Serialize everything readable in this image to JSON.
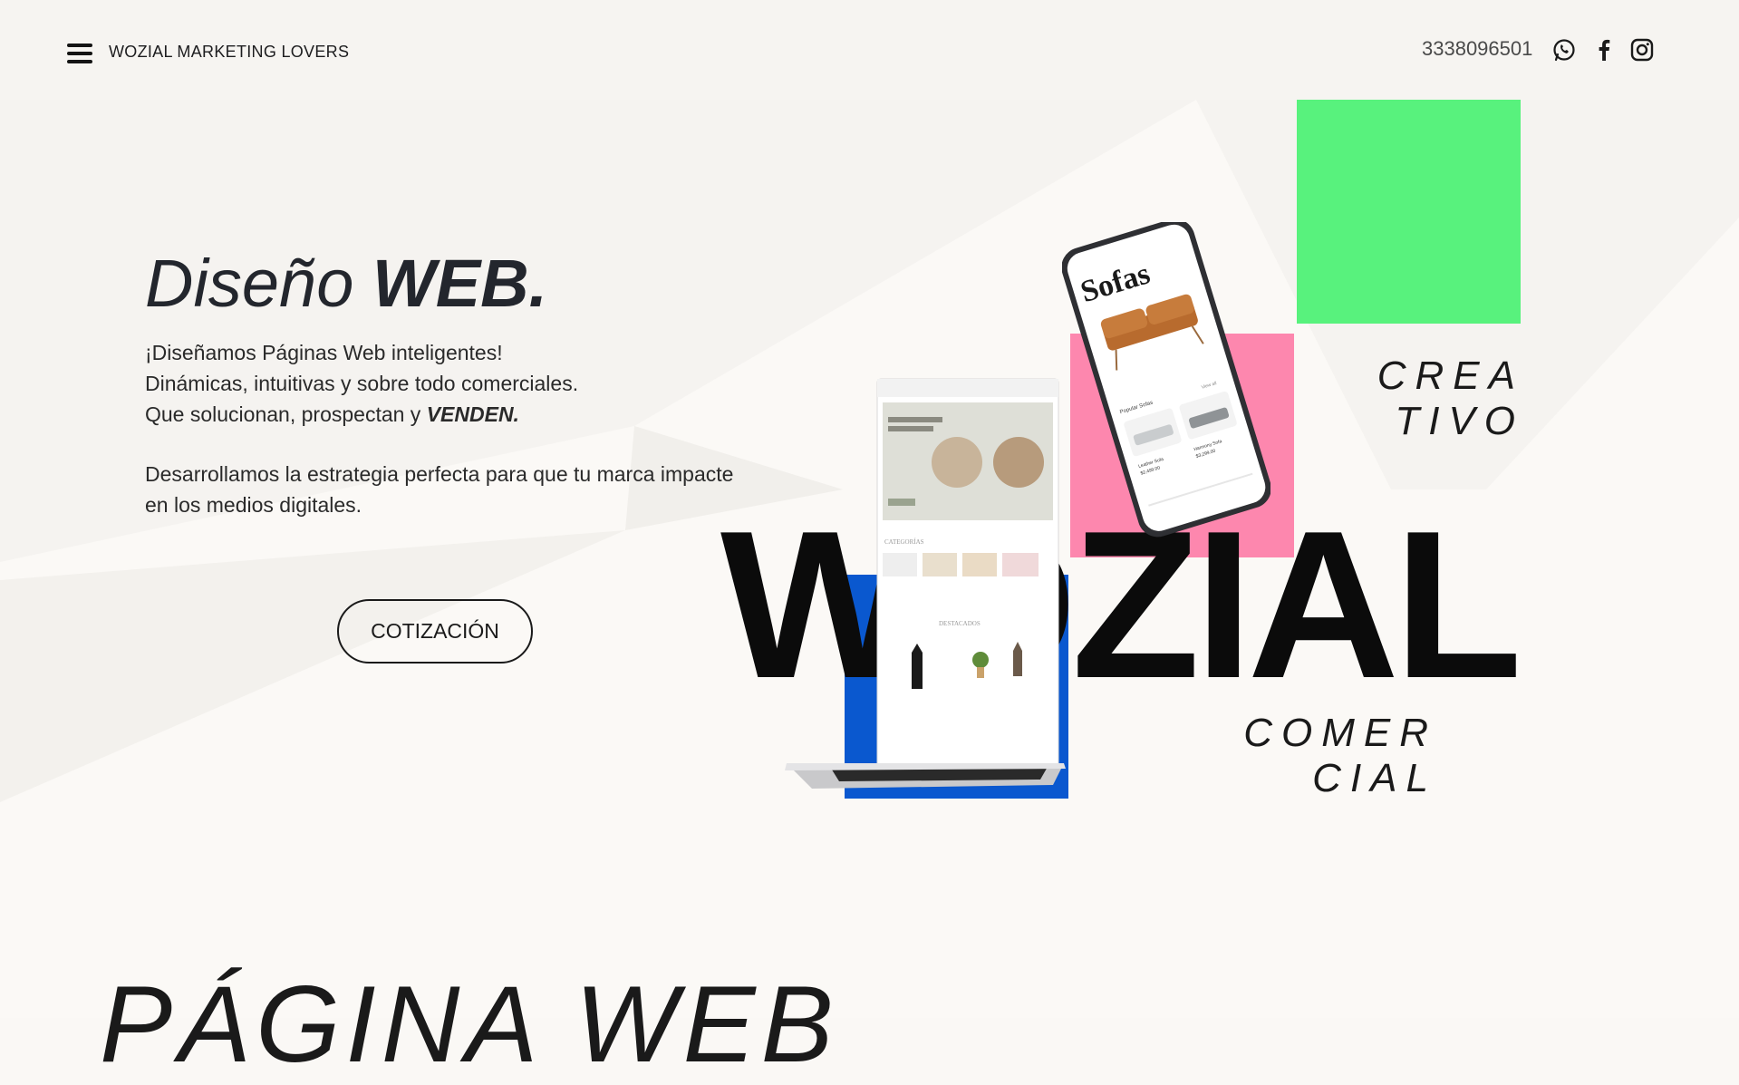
{
  "header": {
    "brand": "WOZIAL MARKETING LOVERS",
    "phone": "3338096501",
    "social": [
      "whatsapp-icon",
      "facebook-icon",
      "instagram-icon"
    ]
  },
  "hero": {
    "title_light": "Diseño ",
    "title_bold": "WEB.",
    "line1": "¡Diseñamos Páginas Web inteligentes!",
    "line2": "Dinámicas, intuitivas y sobre todo comerciales.",
    "line3_prefix": "Que solucionan, prospectan y ",
    "line3_bold": "VENDEN.",
    "paragraph": "Desarrollamos la estrategia perfecta para que tu marca impacte en los medios digitales.",
    "cta": "COTIZACIÓN"
  },
  "collage": {
    "wordmark": "WOZIAL",
    "crea_1": "CREA",
    "crea_2": "TIVO",
    "comer_1": "COMER",
    "comer_2": "CIAL",
    "phone_screen_title": "Sofas",
    "phone_section": "Popular Sofas",
    "phone_view_all": "View all",
    "phone_item_1": "Leather Sofa",
    "phone_item_1_price": "$2,499.00",
    "phone_item_2": "Harmony Sofa",
    "phone_item_2_price": "$3,299.00",
    "laptop_section_1": "CATEGORÍAS",
    "laptop_section_2": "DESTACADOS"
  },
  "colors": {
    "green": "#58f27d",
    "pink": "#fd87ae",
    "blue": "#0a58cf",
    "background": "#faf8f5"
  },
  "next_section": {
    "title": "PÁGINA WEB"
  }
}
